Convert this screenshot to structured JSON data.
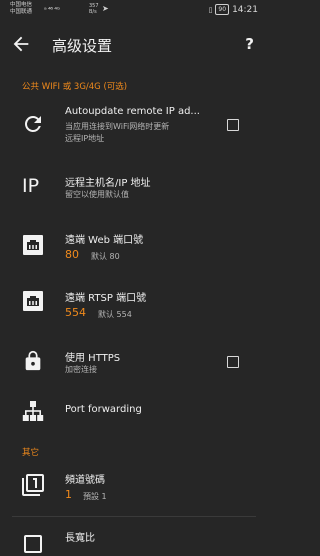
{
  "status_bar": {
    "carrier_1": "中国电信",
    "carrier_2": "中国联通",
    "signal": "ᵃ ⁴⁶ ⁴ᴳ",
    "speed_value": "357",
    "speed_unit": "B/s",
    "battery": "90",
    "time": "14:21"
  },
  "app_bar": {
    "title": "高级设置",
    "help": "?"
  },
  "sections": {
    "wifi": "公共 WIFI 或 3G/4G (可选)",
    "other": "其它"
  },
  "rows": {
    "autoupdate": {
      "title": "Autoupdate remote IP ad...",
      "subtitle_1": "当应用连接到WiFi网络时更新",
      "subtitle_2": "远程IP地址",
      "checked": false
    },
    "remote_host": {
      "title": "远程主机名/IP 地址",
      "subtitle": "留空以使用默认值",
      "icon_text": "IP"
    },
    "web_port": {
      "title": "遠端 Web 端口號",
      "value": "80",
      "default": "默认 80"
    },
    "rtsp_port": {
      "title": "遠端 RTSP 端口號",
      "value": "554",
      "default": "默认 554"
    },
    "https": {
      "title": "使用 HTTPS",
      "subtitle": "加密连接",
      "checked": false
    },
    "port_forwarding": {
      "title": "Port forwarding"
    },
    "channel": {
      "title": "頻道號碼",
      "value": "1",
      "default": "預設 1",
      "icon_text": "1"
    },
    "aspect": {
      "title": "長寬比"
    }
  },
  "colors": {
    "background": "#262626",
    "accent": "#f08a1c",
    "text": "#f0f0f0",
    "secondary_text": "#b5b5b5"
  }
}
